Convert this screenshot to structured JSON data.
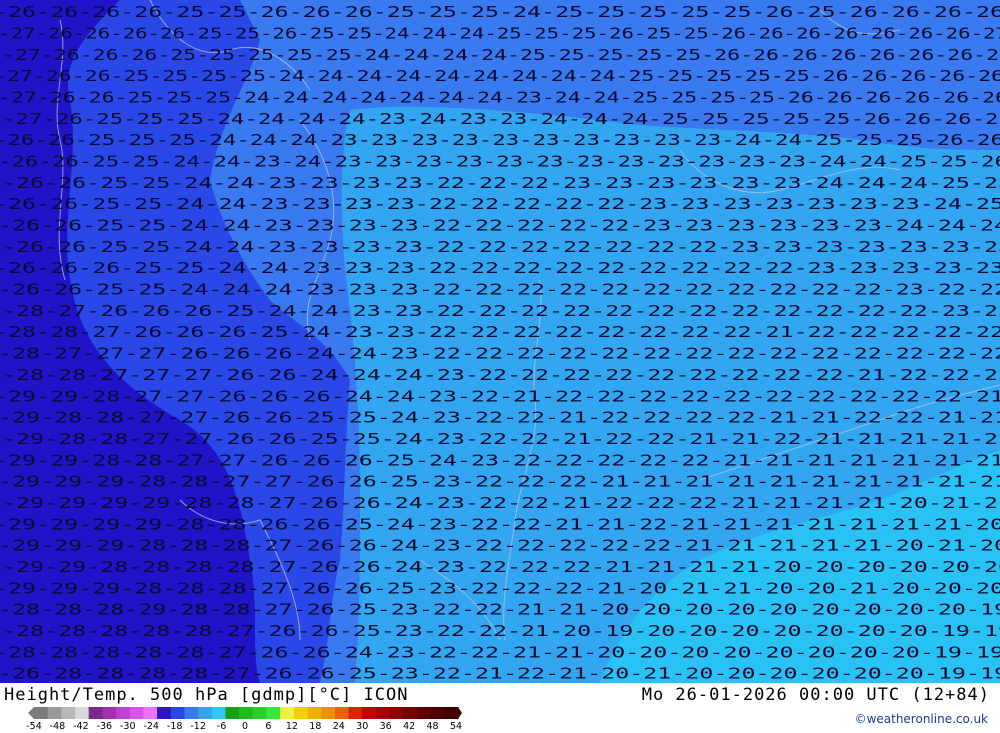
{
  "map": {
    "product": "Height/Temp. 500 hPa [gdmp][°C] ICON",
    "valid_time": "Mo 26-01-2026 00:00 UTC (12+84)",
    "credit": "©weatheronline.co.uk",
    "region_colors": {
      "very_cold": "#1f14c8",
      "cold": "#2a48e8",
      "mid": "#3a7af0",
      "mild": "#32a6f0",
      "warm": "#28c2f5"
    },
    "contour_rows": [
      "-26-26-26-26-25-25-26-26-26-25-25-25-24-25-25-25-25-25-26-25-26-26-26-26",
      "-27-26-26-26-26-25-25-26-25-25-24-24-24-25-25-25-26-25-25-26-26-26-26-26-26-26-27",
      "-27-26-26-26-25-25-25-25-25-24-24-24-24-25-25-25-25-25-26-26-26-26-26-26-26-26",
      "-27-26-26-25-25-25-25-24-24-24-24-24-24-24-24-24-25-25-25-25-25-26-26-26-26-26",
      "-27-26-26-25-25-25-24-24-24-24-24-24-24-23-24-24-25-25-25-25-26-26-26-26-26-26",
      "-27-26-25-25-25-24-24-24-24-23-24-23-23-24-24-24-25-25-25-25-25-26-26-26-26",
      "-26-26-25-25-25-24-24-24-23-23-23-23-23-23-23-23-23-23-24-24-25-25-25-26-26",
      "-26-26-25-25-24-24-23-24-23-23-23-23-23-23-23-23-23-23-23-23-24-24-25-25-26",
      "-26-26-25-25-24-24-23-23-23-23-22-22-22-23-23-23-23-23-23-24-24-24-25-25",
      "-26-26-25-25-24-24-23-23-23-23-22-22-22-22-22-23-23-23-23-23-23-23-24-25",
      "-26-26-25-25-24-24-23-23-23-23-22-22-22-22-22-23-23-23-23-23-23-24-24-24",
      "-26-26-25-25-24-24-23-23-23-23-22-22-22-22-22-22-22-23-23-23-23-23-23-23",
      "-26-26-26-25-25-24-24-23-23-23-22-22-22-22-22-22-22-22-22-23-23-23-23-23",
      "-26-26-25-25-24-24-24-23-23-23-22-22-22-22-22-22-22-22-22-22-22-23-22-22",
      "-28-27-26-26-26-25-24-24-23-23-22-22-22-22-22-22-22-22-22-22-22-22-23-22",
      "-28-28-27-26-26-26-25-24-23-23-22-22-22-22-22-22-22-22-21-22-22-22-22-22",
      "-28-27-27-27-26-26-26-24-24-23-22-22-22-22-22-22-22-22-22-22-22-22-22-22",
      "-28-28-27-27-27-26-26-24-24-24-23-22-22-22-22-22-22-22-22-22-21-22-22-22",
      "-29-29-28-27-27-26-26-26-24-24-23-22-21-22-22-22-22-22-22-22-22-22-22-21",
      "-29-28-28-27-27-26-26-25-25-24-23-22-22-21-22-22-22-22-21-21-22-22-21-21",
      "-29-28-28-27-27-26-26-25-25-24-23-22-22-21-22-22-21-21-22-21-21-21-21-21",
      "-29-29-28-28-27-27-26-26-26-25-24-23-22-22-22-22-22-21-21-21-21-21-21-21",
      "-29-29-29-28-28-27-27-26-26-25-23-22-22-22-21-21-21-21-21-21-21-21-21-21",
      "-29-29-29-29-28-28-27-26-26-24-23-22-22-21-22-22-22-21-21-21-21-20-21-21",
      "-29-29-29-29-28-28-26-26-25-24-23-22-22-21-21-22-21-21-21-21-21-21-21-20",
      "-29-29-29-28-28-28-27-26-26-24-23-22-22-22-22-22-21-21-21-21-21-20-21-20",
      "-29-29-28-28-28-28-27-26-26-24-23-22-22-22-21-21-21-21-20-20-20-20-20-20",
      "-29-29-29-28-28-28-27-26-26-25-23-22-22-22-21-20-21-21-20-20-21-20-20-20",
      "-28-28-28-29-28-28-27-26-25-23-22-22-21-21-20-20-20-20-20-20-20-20-20-19",
      "-28-28-28-28-28-27-26-26-25-23-22-22-21-20-19-20-20-20-20-20-20-20-19-19",
      "-28-28-28-28-28-27-26-26-24-23-22-22-21-21-20-20-20-20-20-20-20-20-19-19",
      "-26-28-28-28-28-27-26-26-25-23-22-21-22-21-20-21-20-20-20-20-20-20-19-19"
    ]
  },
  "legend": {
    "colors": [
      "#7a7a7a",
      "#9a9a9a",
      "#b8b8b8",
      "#d8d8d8",
      "#7a2a8a",
      "#a030b0",
      "#c040d0",
      "#e050f0",
      "#f070ff",
      "#2a14c8",
      "#2a48e8",
      "#3a78f0",
      "#3aa0f0",
      "#30c8f8",
      "#14a014",
      "#1cbc1c",
      "#28d028",
      "#38e838",
      "#f0f040",
      "#f0d000",
      "#f0b000",
      "#f09000",
      "#f06000",
      "#e02000",
      "#c80000",
      "#a80000",
      "#900000",
      "#780000",
      "#600000",
      "#500000",
      "#400000"
    ],
    "labels": [
      "-54",
      "-48",
      "-42",
      "-36",
      "-30",
      "-24",
      "-18",
      "-12",
      "-6",
      "0",
      "6",
      "12",
      "18",
      "24",
      "30",
      "36",
      "42",
      "48",
      "54"
    ]
  }
}
